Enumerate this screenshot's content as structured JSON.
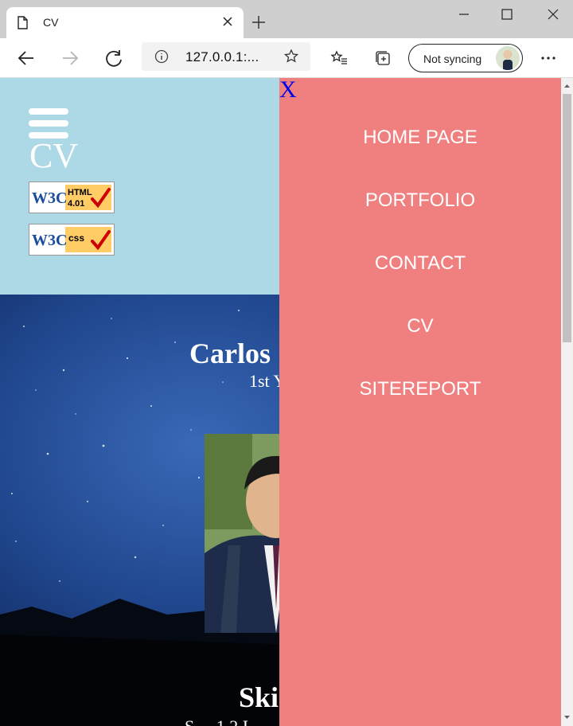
{
  "browser": {
    "tab_title": "CV",
    "url": "127.0.0.1:...",
    "sync_label": "Not syncing"
  },
  "page": {
    "header": {
      "title": "CV",
      "badges": [
        {
          "name": "w3c-html-badge",
          "logo_text": "W3C",
          "label": "HTML 4.01"
        },
        {
          "name": "w3c-css-badge",
          "logo_text": "W3C",
          "label": "CSS"
        }
      ]
    },
    "hero": {
      "name": "Carlos",
      "subtitle": "1st Y",
      "skills_heading": "Ski",
      "skills_sub": "S.... 1 2 I"
    },
    "sidenav": {
      "close_label": "X",
      "links": [
        "HOME PAGE",
        "PORTFOLIO",
        "CONTACT",
        "CV",
        "SITEREPORT"
      ]
    }
  },
  "colors": {
    "header_band": "#add8e6",
    "sidenav": "#f08080",
    "close_link": "#0000ee"
  }
}
